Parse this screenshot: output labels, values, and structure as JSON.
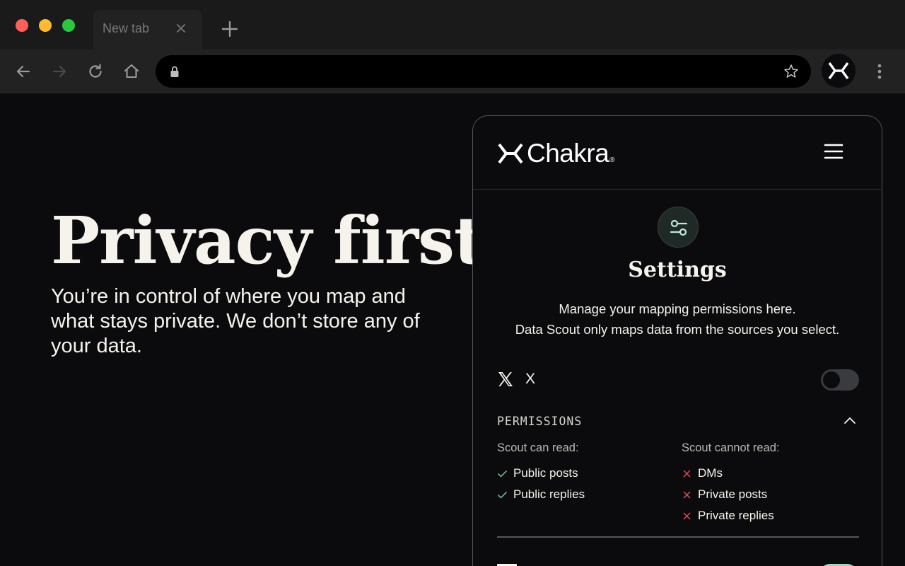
{
  "browser": {
    "tab_title": "New tab",
    "address_value": ""
  },
  "hero": {
    "title": "Privacy first",
    "body": "You’re in control of where you map and what stays private. We don’t store any of your data."
  },
  "panel": {
    "brand": "Chakra",
    "brand_mark": "®",
    "settings_title": "Settings",
    "settings_desc_line1": "Manage your mapping permissions here.",
    "settings_desc_line2": "Data Scout only maps data from the sources you select.",
    "source": {
      "label": "X",
      "enabled": false
    },
    "permissions": {
      "title": "PERMISSIONS",
      "expanded": true,
      "can_read_heading": "Scout can read:",
      "can_read": [
        "Public posts",
        "Public replies"
      ],
      "cannot_read_heading": "Scout cannot read:",
      "cannot_read": [
        "DMs",
        "Private posts",
        "Private replies"
      ]
    }
  },
  "colors": {
    "accent_check": "#6fcf97",
    "accent_cross": "#e5484d",
    "toggle_on": "#9fd6c4"
  }
}
